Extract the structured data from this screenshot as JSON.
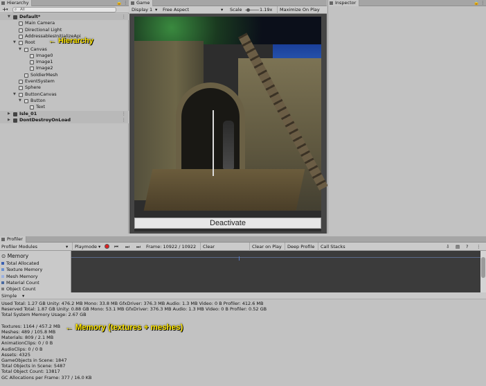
{
  "hierarchy": {
    "tab": "Hierarchy",
    "add": "+",
    "search_placeholder": "All",
    "rows": [
      {
        "label": "Default*",
        "indent": 1,
        "kind": "scene",
        "expanded": true
      },
      {
        "label": "Main Camera",
        "indent": 2,
        "kind": "obj"
      },
      {
        "label": "Directional Light",
        "indent": 2,
        "kind": "obj"
      },
      {
        "label": "AddressablesInitializeApi",
        "indent": 2,
        "kind": "obj"
      },
      {
        "label": "Root",
        "indent": 2,
        "kind": "obj",
        "expanded": true
      },
      {
        "label": "Canvas",
        "indent": 3,
        "kind": "obj",
        "expanded": true
      },
      {
        "label": "Image0",
        "indent": 4,
        "kind": "obj"
      },
      {
        "label": "Image1",
        "indent": 4,
        "kind": "obj"
      },
      {
        "label": "Image2",
        "indent": 4,
        "kind": "obj"
      },
      {
        "label": "SoldierMesh",
        "indent": 3,
        "kind": "obj"
      },
      {
        "label": "EventSystem",
        "indent": 2,
        "kind": "obj"
      },
      {
        "label": "Sphere",
        "indent": 2,
        "kind": "obj"
      },
      {
        "label": "ButtonCanvas",
        "indent": 2,
        "kind": "obj",
        "expanded": true
      },
      {
        "label": "Button",
        "indent": 3,
        "kind": "obj",
        "expanded": true
      },
      {
        "label": "Text",
        "indent": 4,
        "kind": "obj"
      },
      {
        "label": "Isle_01",
        "indent": 1,
        "kind": "scene",
        "expanded": false
      },
      {
        "label": "DontDestroyOnLoad",
        "indent": 1,
        "kind": "scene",
        "expanded": false
      }
    ],
    "annotation": "← Hierarchy"
  },
  "game": {
    "tab": "Game",
    "display": "Display 1",
    "aspect": "Free Aspect",
    "scale_label": "Scale",
    "scale_value": "1.19x",
    "maximize": "Maximize On Play",
    "button_label": "Deactivate"
  },
  "inspector": {
    "tab": "Inspector"
  },
  "profiler": {
    "tab": "Profiler",
    "modules": "Profiler Modules",
    "playmode": "Playmode",
    "frame": "Frame: 10922 / 10922",
    "clear": "Clear",
    "clear_on_play": "Clear on Play",
    "deep_profile": "Deep Profile",
    "call_stacks": "Call Stacks",
    "memory_header": "Memory",
    "memory_items": [
      {
        "label": "Total Allocated",
        "color": "#3b5fb0"
      },
      {
        "label": "Texture Memory",
        "color": "#6a8fd0"
      },
      {
        "label": "Mesh Memory",
        "color": "#9ab0e0"
      },
      {
        "label": "Material Count",
        "color": "#4a6aa0"
      },
      {
        "label": "Object Count",
        "color": "#7a7a7a"
      }
    ],
    "view_mode": "Simple",
    "stats": [
      "Used Total: 1.27 GB   Unity: 476.2 MB   Mono: 33.8 MB   GfxDriver: 376.3 MB   Audio: 1.3 MB   Video: 0 B   Profiler: 412.6 MB",
      "Reserved Total: 1.87 GB   Unity: 0.88 GB   Mono: 53.1 MB   GfxDriver: 376.3 MB   Audio: 1.3 MB   Video: 0 B   Profiler: 0.52 GB",
      "Total System Memory Usage: 2.67 GB",
      "",
      "Textures: 1164 / 457.2 MB",
      "Meshes: 489 / 105.8 MB",
      "Materials: 809 / 2.1 MB",
      "AnimationClips: 0 / 0 B",
      "AudioClips: 0 / 0 B",
      "Assets: 4325",
      "GameObjects in Scene: 1847",
      "Total Objects in Scene: 5487",
      "Total Object Count: 13817",
      "GC Allocations per Frame: 377 / 16.0 KB"
    ],
    "annotation": "← Memory (textures + meshes)"
  }
}
